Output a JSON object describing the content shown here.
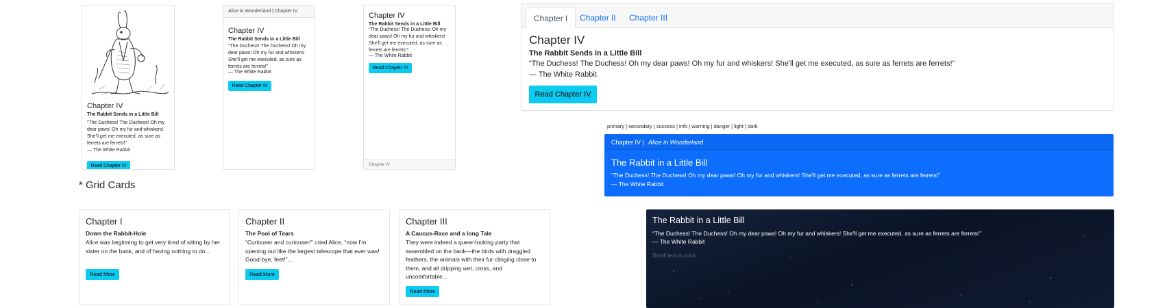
{
  "chapter_iv": {
    "title": "Chapter IV",
    "subtitle": "The Rabbit Sends in a Little Bill",
    "quote": "“The Duchess! The Duchess! Oh my dear paws! Oh my fur and whiskers! She'll get me executed, as sure as ferrets are ferrets!”",
    "attribution": "— The White Rabbit",
    "button": "Read Chapter IV"
  },
  "header_card": {
    "header": "Alice in Wonderland | Chapter IV"
  },
  "footer_card": {
    "footer": "Chapter IV"
  },
  "tabs_card": {
    "tabs": [
      "Chapter I",
      "Chapter II",
      "Chapter III"
    ],
    "active_tab": "Chapter I"
  },
  "variants": {
    "label": "primary | secondary | success | info | warning | danger | light | dark"
  },
  "primary_card": {
    "header_chapter": "Chapter IV | ",
    "header_book": "Alice in Wonderland",
    "title": "The Rabbit in a Little Bill",
    "quote": "“The Duchess! The Duchess! Oh my dear paws! Oh my fur and whiskers! She'll get me executed, as sure as ferrets are ferrets!”",
    "attribution": "— The White Rabbit"
  },
  "grid_heading": "* Grid Cards",
  "grid_cards": [
    {
      "title": "Chapter I",
      "subtitle": "Down the Rabbit-Hole",
      "text": "Alice was beginning to get very tired of sitting by her sister on the bank, and of having nothing to do...",
      "button": "Read More"
    },
    {
      "title": "Chapter II",
      "subtitle": "The Pool of Tears",
      "text": "“Curiouser and curiouser!” cried Alice, “now I'm opening out like the largest telescope that ever was! Good-bye, feet!”...",
      "button": "Read More"
    },
    {
      "title": "Chapter III",
      "subtitle": "A Caucus-Race and a long Tale",
      "text": "They were indeed a queer-looking party that assembled on the bank—the birds with draggled feathers, the animals with their fur clinging close to them, and all dripping wet, cross, and uncomfortable...",
      "button": "Read More"
    }
  ],
  "overlay_card": {
    "title": "The Rabbit in a Little Bill",
    "quote": "“The Duchess! The Duchess! Oh my dear paws! Oh my fur and whiskers! She'll get me executed, as sure as ferrets are ferrets!”",
    "attribution": "— The White Rabbit",
    "small_text": "Small text in color"
  },
  "colors": {
    "info": "#0dcaf0",
    "primary": "#0d6efd",
    "dark_bg": "#0b1426"
  }
}
